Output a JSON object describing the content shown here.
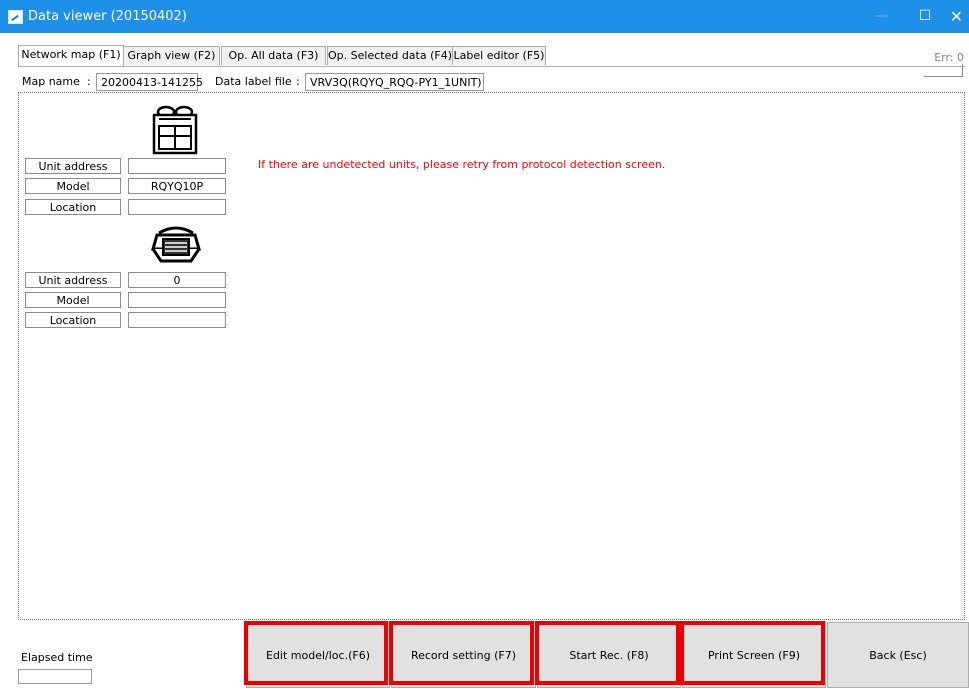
{
  "window": {
    "title": "Data viewer (20150402)",
    "minimize": "—",
    "maximize": "☐",
    "close": "✕"
  },
  "tabs": [
    {
      "label": "Network map (F1)",
      "active": true
    },
    {
      "label": "Graph view (F2)",
      "active": false
    },
    {
      "label": "Op. All data (F3)",
      "active": false
    },
    {
      "label": "Op. Selected data (F4)",
      "active": false
    },
    {
      "label": "Label editor (F5)",
      "active": false
    }
  ],
  "err": "Err: 0",
  "header": {
    "map_name_label": "Map name",
    "separator": ":",
    "map_name_value": "20200413-141255",
    "data_label_file_label": "Data label file",
    "data_label_file_value": "VRV3Q(RQYQ_RQQ-PY1_1UNIT)"
  },
  "units": [
    {
      "icon": "outdoor-unit-icon",
      "rows": [
        {
          "label": "Unit address",
          "value": ""
        },
        {
          "label": "Model",
          "value": "RQYQ10P"
        },
        {
          "label": "Location",
          "value": ""
        }
      ]
    },
    {
      "icon": "indoor-cassette-unit-icon",
      "rows": [
        {
          "label": "Unit address",
          "value": "0"
        },
        {
          "label": "Model",
          "value": ""
        },
        {
          "label": "Location",
          "value": ""
        }
      ]
    }
  ],
  "notice": "If there are undetected units, please retry from protocol detection screen.",
  "footer": {
    "elapsed_label": "Elapsed time",
    "elapsed_value": "",
    "buttons": [
      {
        "label": "Edit model/loc.(F6)",
        "highlighted": true
      },
      {
        "label": "Record setting (F7)",
        "highlighted": true
      },
      {
        "label": "Start Rec. (F8)",
        "highlighted": true
      },
      {
        "label": "Print Screen (F9)",
        "highlighted": true
      },
      {
        "label": "Back (Esc)",
        "highlighted": false
      }
    ]
  },
  "colors": {
    "titlebar": "#1e90e8",
    "notice": "#ff0000",
    "highlight": "#ee0000",
    "button_face": "#e1e1e1"
  }
}
